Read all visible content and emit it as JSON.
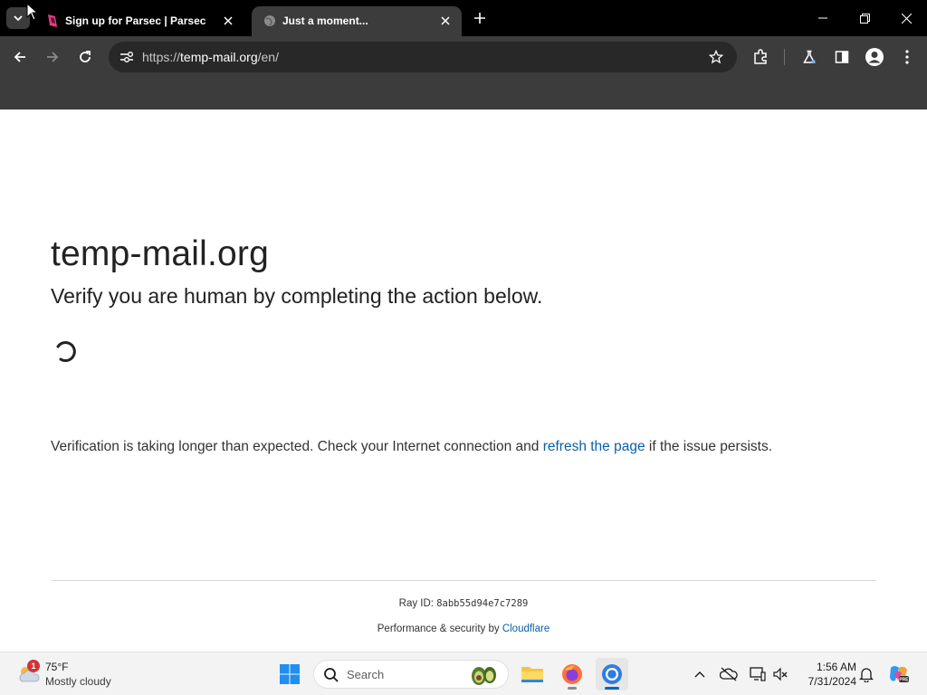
{
  "browser": {
    "tabs": [
      {
        "title": "Sign up for Parsec | Parsec",
        "active": false,
        "favicon": "parsec-logo-icon"
      },
      {
        "title": "Just a moment...",
        "active": true,
        "favicon": "globe-icon"
      }
    ],
    "url_scheme": "https://",
    "url_host": "temp-mail.org",
    "url_path": "/en/"
  },
  "page": {
    "site_heading": "temp-mail.org",
    "verify_text": "Verify you are human by completing the action below.",
    "slow_message_before": "Verification is taking longer than expected. Check your Internet connection and ",
    "slow_message_link": "refresh the page",
    "slow_message_after": " if the issue persists.",
    "ray_label": "Ray ID: ",
    "ray_id": "8abb55d94e7c7289",
    "perf_label": "Performance & security by ",
    "perf_link": "Cloudflare"
  },
  "taskbar": {
    "weather_badge": "1",
    "weather_temp": "75°F",
    "weather_condition": "Mostly cloudy",
    "search_placeholder": "Search",
    "time": "1:56 AM",
    "date": "7/31/2024"
  },
  "colors": {
    "tabstrip_bg": "#000000",
    "toolbar_bg": "#3c3c3c",
    "link_blue": "#0b5fa8",
    "accent_blue": "#0067c0"
  }
}
